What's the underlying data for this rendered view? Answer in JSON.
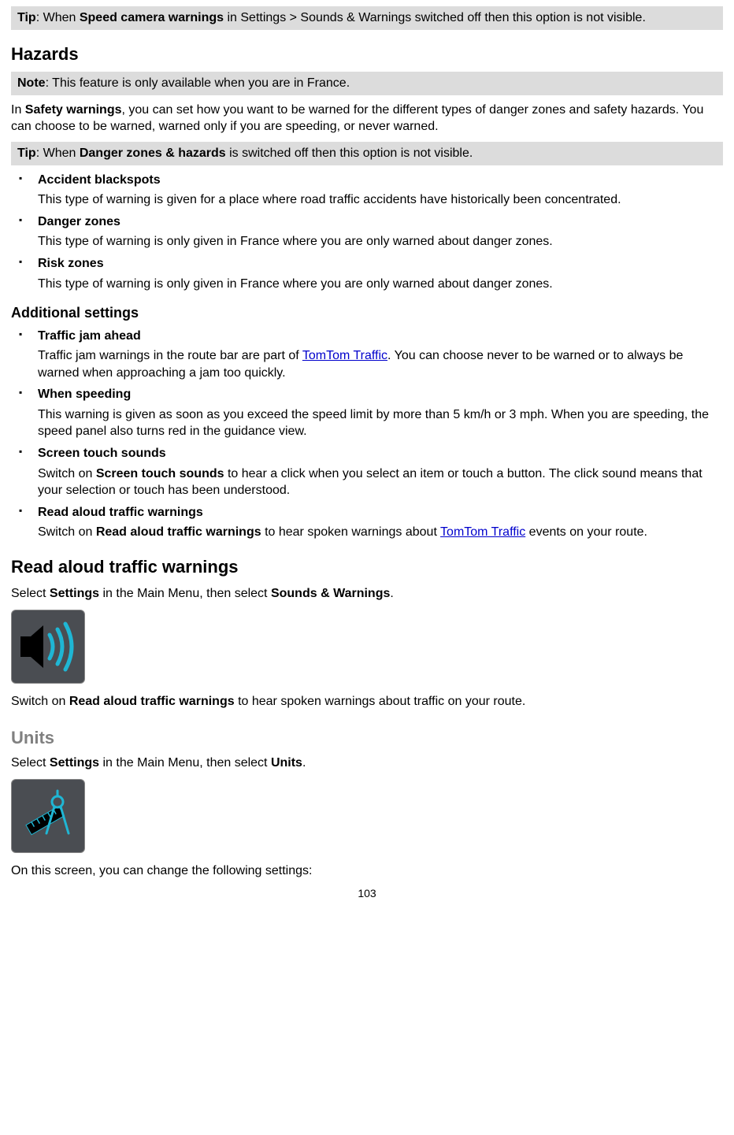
{
  "tip1": {
    "label": "Tip",
    "bold_phrase": "Speed camera warnings",
    "prefix": ": When ",
    "suffix": " in Settings > Sounds & Warnings switched off then this option is not visible."
  },
  "hazards_heading": "Hazards",
  "note1": {
    "label": "Note",
    "text": ": This feature is only available when you are in France."
  },
  "intro": {
    "prefix": "In ",
    "bold": "Safety warnings",
    "rest": ", you can set how you want to be warned for the different types of danger zones and safety hazards. You can choose to be warned, warned only if you are speeding, or never warned."
  },
  "tip2": {
    "label": "Tip",
    "prefix": ": When ",
    "bold_phrase": "Danger zones & hazards",
    "suffix": " is switched off then this option is not visible."
  },
  "list1": [
    {
      "title": "Accident blackspots",
      "desc": "This type of warning is given for a place where road traffic accidents have historically been concentrated."
    },
    {
      "title": "Danger zones",
      "desc": "This type of warning is only given in France where you are only warned about danger zones."
    },
    {
      "title": "Risk zones",
      "desc": "This type of warning is only given in France where you are only warned about danger zones."
    }
  ],
  "additional_heading": "Additional settings",
  "list2": {
    "traffic_jam": {
      "title": "Traffic jam ahead",
      "desc_prefix": "Traffic jam warnings in the route bar are part of ",
      "link": "TomTom Traffic",
      "desc_suffix": ". You can choose never to be warned or to always be warned when approaching a jam too quickly."
    },
    "when_speeding": {
      "title": "When speeding",
      "desc": "This warning is given as soon as you exceed the speed limit by more than 5 km/h or 3 mph. When you are speeding, the speed panel also turns red in the guidance view."
    },
    "screen_touch": {
      "title": "Screen touch sounds",
      "desc_prefix": "Switch on ",
      "bold": "Screen touch sounds",
      "desc_suffix": " to hear a click when you select an item or touch a button. The click sound means that your selection or touch has been understood."
    },
    "read_aloud": {
      "title": "Read aloud traffic warnings",
      "desc_prefix": "Switch on ",
      "bold": "Read aloud traffic warnings",
      "desc_mid": " to hear spoken warnings about ",
      "link": "TomTom Traffic",
      "desc_suffix": " events on your route."
    }
  },
  "read_aloud_heading": "Read aloud traffic warnings",
  "read_aloud_instr": {
    "prefix": "Select ",
    "b1": "Settings",
    "mid": " in the Main Menu, then select ",
    "b2": "Sounds & Warnings",
    "suffix": "."
  },
  "read_aloud_switch": {
    "prefix": "Switch on ",
    "bold": "Read aloud traffic warnings",
    "suffix": " to hear spoken warnings about traffic on your route."
  },
  "units_heading": "Units",
  "units_instr": {
    "prefix": "Select ",
    "b1": "Settings",
    "mid": " in the Main Menu, then select ",
    "b2": "Units",
    "suffix": "."
  },
  "units_screen": "On this screen, you can change the following settings:",
  "page_number": "103"
}
